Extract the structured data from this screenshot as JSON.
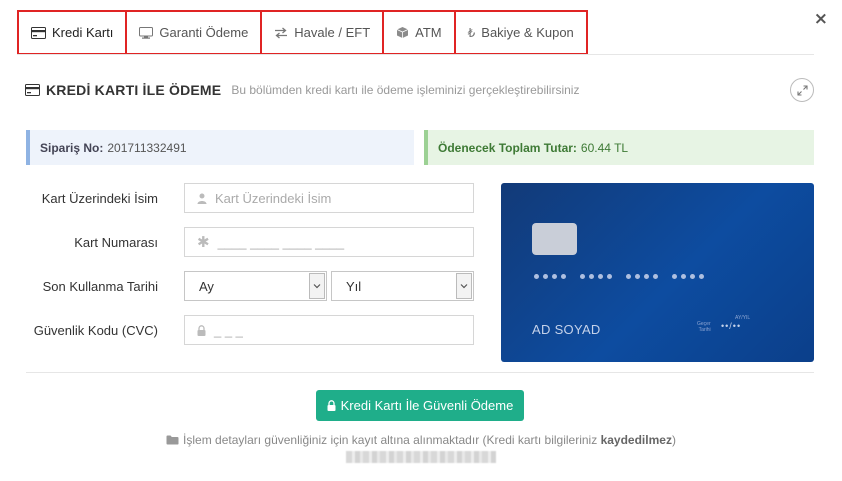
{
  "close_label": "×",
  "tabs": [
    {
      "label": "Kredi Kartı",
      "icon": "credit-card-icon",
      "active": true
    },
    {
      "label": "Garanti Ödeme",
      "icon": "monitor-icon",
      "active": false
    },
    {
      "label": "Havale / EFT",
      "icon": "transfer-arrows-icon",
      "active": false
    },
    {
      "label": "ATM",
      "icon": "box-icon",
      "active": false
    },
    {
      "label": "Bakiye & Kupon",
      "icon": "lira-icon",
      "active": false
    }
  ],
  "section": {
    "title": "KREDİ KARTI İLE ÖDEME",
    "subtitle": "Bu bölümden kredi kartı ile ödeme işleminizi gerçekleştirebilirsiniz"
  },
  "order": {
    "label": "Sipariş No:",
    "value": "201711332491"
  },
  "total": {
    "label": "Ödenecek Toplam Tutar:",
    "value": "60.44 TL"
  },
  "form": {
    "name_label": "Kart Üzerindeki İsim",
    "name_placeholder": "Kart Üzerindeki İsim",
    "number_label": "Kart Numarası",
    "number_placeholder": "____ ____ ____ ____",
    "expiry_label": "Son Kullanma Tarihi",
    "month_value": "Ay",
    "year_value": "Yıl",
    "cvc_label": "Güvenlik Kodu (CVC)",
    "cvc_placeholder": "_ _ _"
  },
  "card": {
    "holder": "AD SOYAD",
    "expiry_top": "AY/YIL",
    "expiry_label_1": "Geçer",
    "expiry_label_2": "Tarihi",
    "expiry_value": "••/••"
  },
  "pay_button": "Kredi Kartı İle Güvenli Ödeme",
  "note": {
    "text": "İşlem detayları güvenliğiniz için kayıt altına alınmaktadır (Kredi kartı bilgileriniz",
    "bold": "kaydedilmez",
    "suffix": ")"
  },
  "colors": {
    "accent_green": "#1fae8a",
    "tab_highlight": "#e02424",
    "card_blue": "#0d4ca0",
    "info_blue": "#eef3fb",
    "info_green": "#e7f4e4"
  }
}
